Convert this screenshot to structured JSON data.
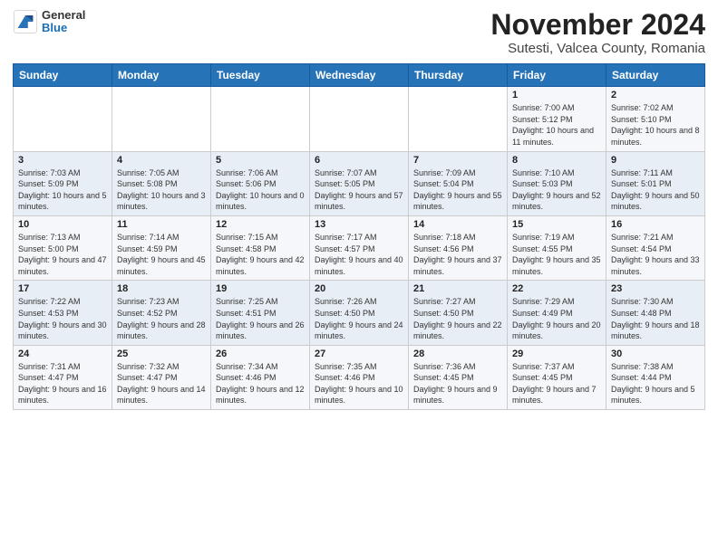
{
  "header": {
    "logo_line1": "General",
    "logo_line2": "Blue",
    "title": "November 2024",
    "subtitle": "Sutesti, Valcea County, Romania"
  },
  "weekdays": [
    "Sunday",
    "Monday",
    "Tuesday",
    "Wednesday",
    "Thursday",
    "Friday",
    "Saturday"
  ],
  "weeks": [
    [
      {
        "day": null
      },
      {
        "day": null
      },
      {
        "day": null
      },
      {
        "day": null
      },
      {
        "day": null
      },
      {
        "day": "1",
        "sunrise": "7:00 AM",
        "sunset": "5:12 PM",
        "daylight": "10 hours and 11 minutes."
      },
      {
        "day": "2",
        "sunrise": "7:02 AM",
        "sunset": "5:10 PM",
        "daylight": "10 hours and 8 minutes."
      }
    ],
    [
      {
        "day": "3",
        "sunrise": "7:03 AM",
        "sunset": "5:09 PM",
        "daylight": "10 hours and 5 minutes."
      },
      {
        "day": "4",
        "sunrise": "7:05 AM",
        "sunset": "5:08 PM",
        "daylight": "10 hours and 3 minutes."
      },
      {
        "day": "5",
        "sunrise": "7:06 AM",
        "sunset": "5:06 PM",
        "daylight": "10 hours and 0 minutes."
      },
      {
        "day": "6",
        "sunrise": "7:07 AM",
        "sunset": "5:05 PM",
        "daylight": "9 hours and 57 minutes."
      },
      {
        "day": "7",
        "sunrise": "7:09 AM",
        "sunset": "5:04 PM",
        "daylight": "9 hours and 55 minutes."
      },
      {
        "day": "8",
        "sunrise": "7:10 AM",
        "sunset": "5:03 PM",
        "daylight": "9 hours and 52 minutes."
      },
      {
        "day": "9",
        "sunrise": "7:11 AM",
        "sunset": "5:01 PM",
        "daylight": "9 hours and 50 minutes."
      }
    ],
    [
      {
        "day": "10",
        "sunrise": "7:13 AM",
        "sunset": "5:00 PM",
        "daylight": "9 hours and 47 minutes."
      },
      {
        "day": "11",
        "sunrise": "7:14 AM",
        "sunset": "4:59 PM",
        "daylight": "9 hours and 45 minutes."
      },
      {
        "day": "12",
        "sunrise": "7:15 AM",
        "sunset": "4:58 PM",
        "daylight": "9 hours and 42 minutes."
      },
      {
        "day": "13",
        "sunrise": "7:17 AM",
        "sunset": "4:57 PM",
        "daylight": "9 hours and 40 minutes."
      },
      {
        "day": "14",
        "sunrise": "7:18 AM",
        "sunset": "4:56 PM",
        "daylight": "9 hours and 37 minutes."
      },
      {
        "day": "15",
        "sunrise": "7:19 AM",
        "sunset": "4:55 PM",
        "daylight": "9 hours and 35 minutes."
      },
      {
        "day": "16",
        "sunrise": "7:21 AM",
        "sunset": "4:54 PM",
        "daylight": "9 hours and 33 minutes."
      }
    ],
    [
      {
        "day": "17",
        "sunrise": "7:22 AM",
        "sunset": "4:53 PM",
        "daylight": "9 hours and 30 minutes."
      },
      {
        "day": "18",
        "sunrise": "7:23 AM",
        "sunset": "4:52 PM",
        "daylight": "9 hours and 28 minutes."
      },
      {
        "day": "19",
        "sunrise": "7:25 AM",
        "sunset": "4:51 PM",
        "daylight": "9 hours and 26 minutes."
      },
      {
        "day": "20",
        "sunrise": "7:26 AM",
        "sunset": "4:50 PM",
        "daylight": "9 hours and 24 minutes."
      },
      {
        "day": "21",
        "sunrise": "7:27 AM",
        "sunset": "4:50 PM",
        "daylight": "9 hours and 22 minutes."
      },
      {
        "day": "22",
        "sunrise": "7:29 AM",
        "sunset": "4:49 PM",
        "daylight": "9 hours and 20 minutes."
      },
      {
        "day": "23",
        "sunrise": "7:30 AM",
        "sunset": "4:48 PM",
        "daylight": "9 hours and 18 minutes."
      }
    ],
    [
      {
        "day": "24",
        "sunrise": "7:31 AM",
        "sunset": "4:47 PM",
        "daylight": "9 hours and 16 minutes."
      },
      {
        "day": "25",
        "sunrise": "7:32 AM",
        "sunset": "4:47 PM",
        "daylight": "9 hours and 14 minutes."
      },
      {
        "day": "26",
        "sunrise": "7:34 AM",
        "sunset": "4:46 PM",
        "daylight": "9 hours and 12 minutes."
      },
      {
        "day": "27",
        "sunrise": "7:35 AM",
        "sunset": "4:46 PM",
        "daylight": "9 hours and 10 minutes."
      },
      {
        "day": "28",
        "sunrise": "7:36 AM",
        "sunset": "4:45 PM",
        "daylight": "9 hours and 9 minutes."
      },
      {
        "day": "29",
        "sunrise": "7:37 AM",
        "sunset": "4:45 PM",
        "daylight": "9 hours and 7 minutes."
      },
      {
        "day": "30",
        "sunrise": "7:38 AM",
        "sunset": "4:44 PM",
        "daylight": "9 hours and 5 minutes."
      }
    ]
  ],
  "labels": {
    "sunrise": "Sunrise:",
    "sunset": "Sunset:",
    "daylight": "Daylight:"
  }
}
